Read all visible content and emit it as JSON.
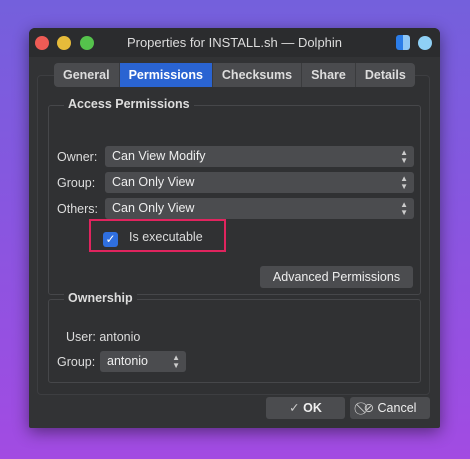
{
  "window": {
    "title": "Properties for INSTALL.sh — Dolphin"
  },
  "tabs": [
    "General",
    "Permissions",
    "Checksums",
    "Share",
    "Details"
  ],
  "access": {
    "title": "Access Permissions",
    "owner": {
      "label": "Owner:",
      "value": "Can View  Modify"
    },
    "group": {
      "label": "Group:",
      "value": "Can Only View"
    },
    "others": {
      "label": "Others:",
      "value": "Can Only View"
    },
    "executable": {
      "label": "Is executable",
      "checked": true
    },
    "advanced": "Advanced Permissions"
  },
  "ownership": {
    "title": "Ownership",
    "user": "User: antonio",
    "group_label": "Group:",
    "group_value": "antonio"
  },
  "buttons": {
    "ok": "OK",
    "cancel": "Cancel"
  },
  "colors": {
    "accent": "#2a64d2",
    "highlight": "#e0245e"
  }
}
